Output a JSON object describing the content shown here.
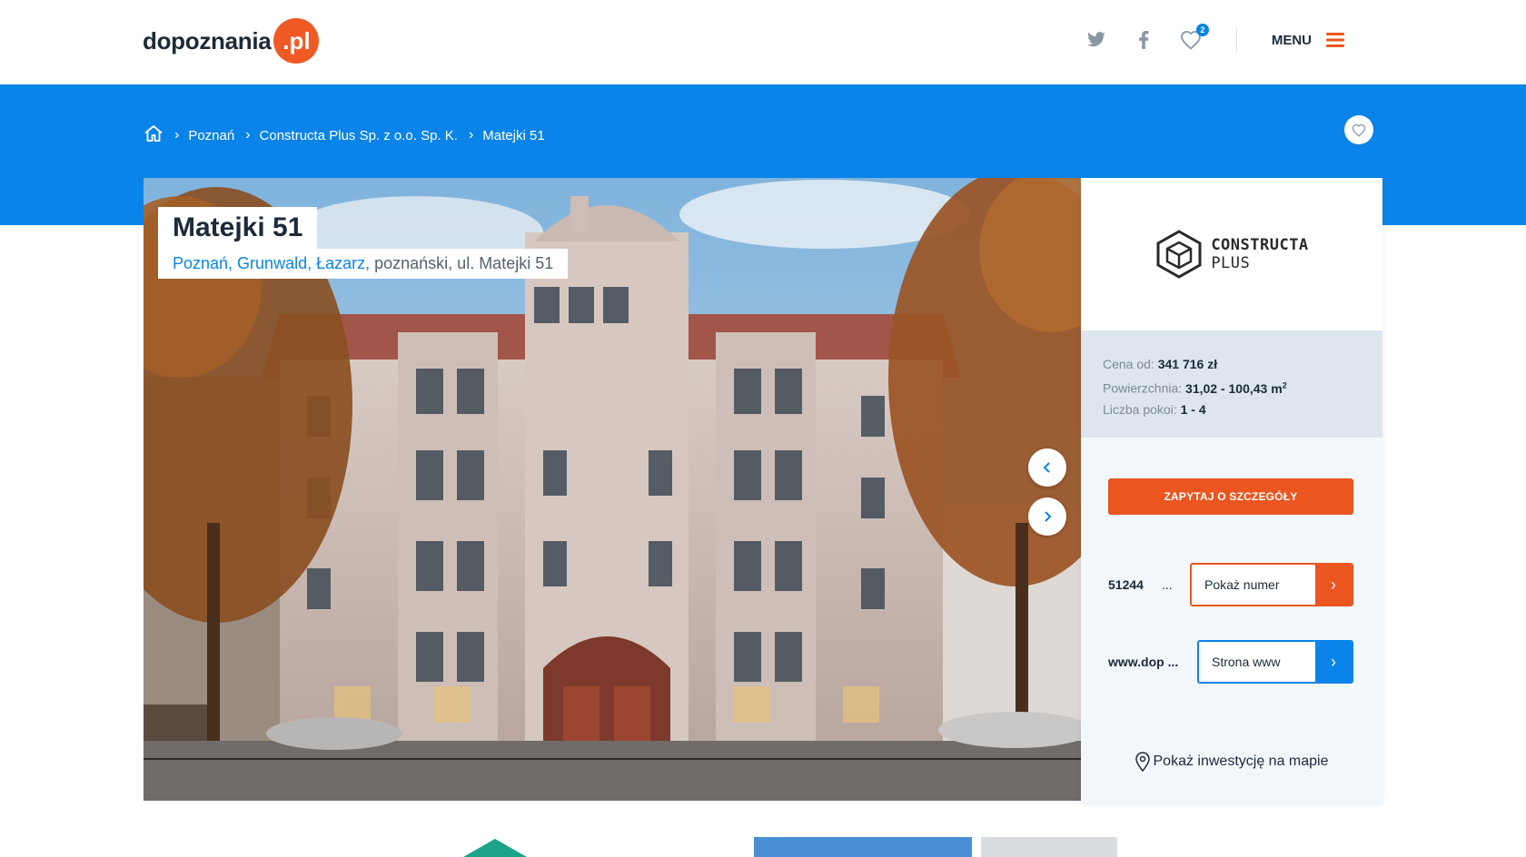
{
  "header": {
    "logo_text": "dopoznania",
    "logo_badge": ".pl",
    "favorites_count": "2",
    "menu_label": "MENU",
    "icons": [
      "twitter-icon",
      "facebook-icon",
      "heart-icon",
      "hamburger-icon"
    ]
  },
  "breadcrumb": {
    "items": [
      "Poznań",
      "Constructa Plus Sp. z o.o. Sp. K.",
      "Matejki 51"
    ]
  },
  "listing": {
    "title": "Matejki 51",
    "location_link": "Poznań, Grunwald, Łazarz,",
    "location_rest": " poznański, ul. Matejki 51"
  },
  "developer": {
    "name_line1": "CONSTRUCTA",
    "name_line2": "PLUS"
  },
  "stats": {
    "price_label": "Cena od: ",
    "price_value": "341 716 zł",
    "area_label": "Powierzchnia: ",
    "area_value": "31,02  - 100,43 m",
    "area_unit_sup": "2",
    "rooms_label": "Liczba pokoi: ",
    "rooms_value": "1 - 4"
  },
  "actions": {
    "cta_label": "ZAPYTAJ O SZCZEGÓŁY",
    "phone_partial": "51244",
    "phone_ellipsis": "...",
    "phone_button": "Pokaż numer",
    "www_partial": "www.dop ...",
    "www_button": "Strona www",
    "map_link": "Pokaż inwestycję na mapie"
  },
  "colors": {
    "brand_orange": "#ea5520",
    "brand_blue": "#0a84e8"
  }
}
